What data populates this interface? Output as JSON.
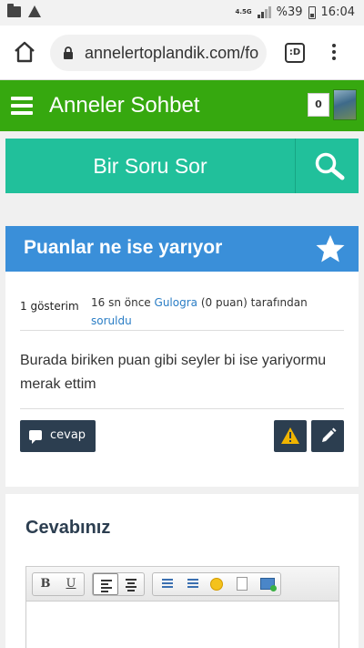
{
  "status_bar": {
    "network": "4.5G",
    "battery": "%39",
    "time": "16:04"
  },
  "browser": {
    "url": "annelertoplandik.com/fo",
    "tab_count": ":D"
  },
  "header": {
    "title": "Anneler Sohbet",
    "points_badge": "0"
  },
  "ask": {
    "label": "Bir Soru Sor"
  },
  "question": {
    "title": "Puanlar ne ise yarıyor",
    "views": "1 gösterim",
    "time_ago": "16 sn önce",
    "author": "Gulogra",
    "author_points": "(0 puan)",
    "by_text": "tarafından",
    "action": "soruldu",
    "body": "Burada biriken puan gibi seyler bi ise yariyormu merak ettim",
    "answer_button": "cevap"
  },
  "answer_section": {
    "title": "Cevabınız",
    "toolbar": {
      "bold": "B",
      "underline": "U"
    }
  },
  "colors": {
    "header_green": "#36a80f",
    "ask_teal": "#21c09b",
    "question_blue": "#3a8fd9",
    "button_dark": "#2c3e50",
    "link_blue": "#2a7dc5"
  }
}
